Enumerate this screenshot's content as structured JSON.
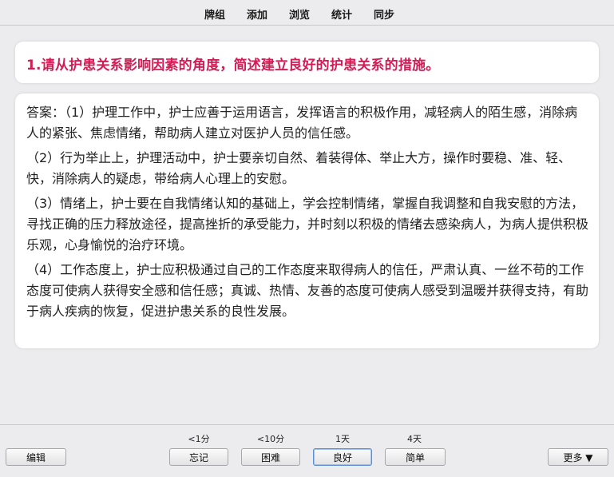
{
  "topbar": {
    "items": [
      {
        "label": "牌组"
      },
      {
        "label": "添加"
      },
      {
        "label": "浏览"
      },
      {
        "label": "统计"
      },
      {
        "label": "同步"
      }
    ]
  },
  "card": {
    "question": "1.请从护患关系影响因素的角度，简述建立良好的护患关系的措施。",
    "answer_paragraphs": [
      "答案：（1）护理工作中，护士应善于运用语言，发挥语言的积极作用，减轻病人的陌生感，消除病人的紧张、焦虑情绪，帮助病人建立对医护人员的信任感。",
      "（2）行为举止上，护理活动中，护士要亲切自然、着装得体、举止大方，操作时要稳、准、轻、快，消除病人的疑虑，带给病人心理上的安慰。",
      "（3）情绪上，护士要在自我情绪认知的基础上，学会控制情绪，掌握自我调整和自我安慰的方法，寻找正确的压力释放途径，提高挫折的承受能力，并时刻以积极的情绪去感染病人，为病人提供积极乐观，心身愉悦的治疗环境。",
      "（4）工作态度上，护士应积极通过自己的工作态度来取得病人的信任，严肃认真、一丝不苟的工作态度可使病人获得安全感和信任感；真诚、热情、友善的态度可使病人感受到温暖并获得支持，有助于病人疾病的恢复，促进护患关系的良性发展。"
    ]
  },
  "bottombar": {
    "edit_label": "编辑",
    "more_label": "更多 ▼",
    "answers": [
      {
        "time": "<1分",
        "label": "忘记"
      },
      {
        "time": "<10分",
        "label": "困难"
      },
      {
        "time": "1天",
        "label": "良好"
      },
      {
        "time": "4天",
        "label": "简单"
      }
    ]
  }
}
